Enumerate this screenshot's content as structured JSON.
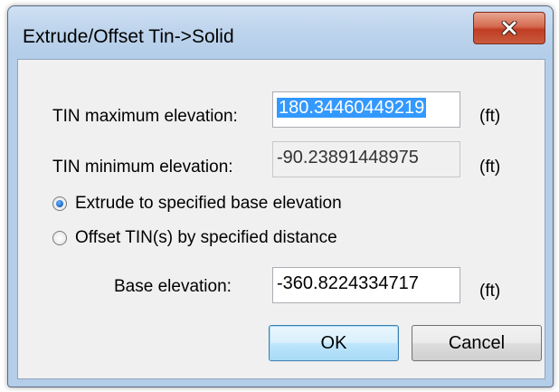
{
  "window": {
    "title": "Extrude/Offset Tin->Solid"
  },
  "fields": {
    "max_label": "TIN maximum elevation:",
    "max_value": "180.34460449219",
    "min_label": "TIN minimum elevation:",
    "min_value": "-90.23891448975",
    "base_label": "Base elevation:",
    "base_value": "-360.8224334717",
    "unit": "(ft)"
  },
  "options": {
    "extrude_label": "Extrude to specified base elevation",
    "offset_label": "Offset TIN(s) by specified distance",
    "selected": "extrude"
  },
  "buttons": {
    "ok": "OK",
    "cancel": "Cancel"
  },
  "colors": {
    "selection": "#3399ff",
    "close_button": "#c03d22"
  }
}
